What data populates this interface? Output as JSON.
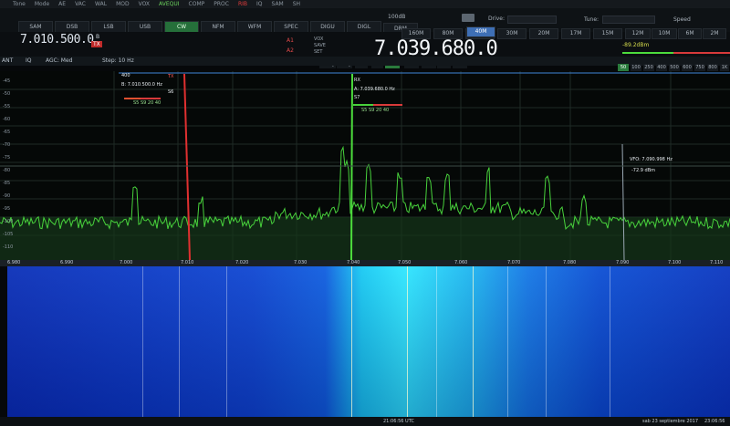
{
  "menu": {
    "items": [
      "Tone",
      "Mode",
      "AE",
      "VAC",
      "WAL",
      "MOD",
      "VOX"
    ],
    "highlight": "AVEQUI",
    "extra": [
      "COMP",
      "PROC"
    ],
    "rec": "RIB",
    "right": [
      "IQ",
      "SAM",
      "SH"
    ]
  },
  "modes": {
    "items": [
      "SAM",
      "DSB",
      "LSB",
      "USB",
      "CW",
      "NFM",
      "WFM",
      "SPEC",
      "DIGU",
      "DIGL",
      "DRM"
    ],
    "active": "CW"
  },
  "header": {
    "db_label": "100dB",
    "drive_label": "Drive:",
    "tune_label": "Tune:",
    "speed_label": "Speed"
  },
  "vfo_b": {
    "freq": "7.010.500.0",
    "label": "B",
    "tx": "TX"
  },
  "dsp": {
    "a1": "A1",
    "a2": "A2",
    "vox_labels": [
      "VOX",
      "SAVE",
      "SET"
    ]
  },
  "main": {
    "freq": "7.039.680.0"
  },
  "bands": {
    "items": [
      "160M",
      "80M",
      "60M",
      "40M",
      "30M",
      "20M",
      "17M",
      "15M",
      "12M",
      "10M",
      "6M",
      "2M"
    ],
    "active": "40M"
  },
  "meter": {
    "dbm": "-89.2dBm",
    "s_reading": "S6",
    "scale": [
      "-100",
      "1",
      "3",
      "5",
      "7",
      "9",
      "+20",
      "+40",
      "+60"
    ]
  },
  "functions": {
    "items": [
      "R.EQ",
      "T.EQ",
      "BIN",
      "NR",
      "NB1",
      "NB2",
      "ANF",
      "APF",
      "DSE"
    ],
    "active": "NB1"
  },
  "controls": {
    "ant": "ANT",
    "mode_label": "IQ",
    "agc": "AGC: Med",
    "step": "Step: 10 Hz"
  },
  "bandwidths": {
    "items": [
      "50",
      "100",
      "250",
      "400",
      "500",
      "600",
      "750",
      "800",
      "1K"
    ],
    "active": "50"
  },
  "spectrum": {
    "db_labels": [
      "-45",
      "-50",
      "-55",
      "-60",
      "-65",
      "-70",
      "-75",
      "-80",
      "-85",
      "-90",
      "-95",
      "-100",
      "-105",
      "-110"
    ],
    "tx_flag": {
      "title": "TX",
      "top": "400",
      "freq": "B: 7.010.500.0 Hz",
      "s_meter": "S6",
      "scale": "S5 S9 20 40"
    },
    "rx_flag": {
      "title": "RX",
      "freq": "A: 7.039.680.0 Hz",
      "s_meter": "S7",
      "scale": "S5 S9 20 40"
    },
    "cursor": {
      "vfo": "VFO: 7.090.998 Hz",
      "level": "-72.9 dBm"
    },
    "tx_color": "#e03030",
    "rx_color": "#4cdc3c",
    "trace_color": "#48d23c"
  },
  "freq_axis": [
    "6.980",
    "6.990",
    "7.000",
    "7.010",
    "7.020",
    "7.030",
    "7.040",
    "7.050",
    "7.060",
    "7.070",
    "7.080",
    "7.090",
    "7.100",
    "7.110"
  ],
  "status": {
    "utc": "21:06:56 UTC",
    "date": "sab 23 septiembre 2017",
    "clock": "23:06:56"
  }
}
